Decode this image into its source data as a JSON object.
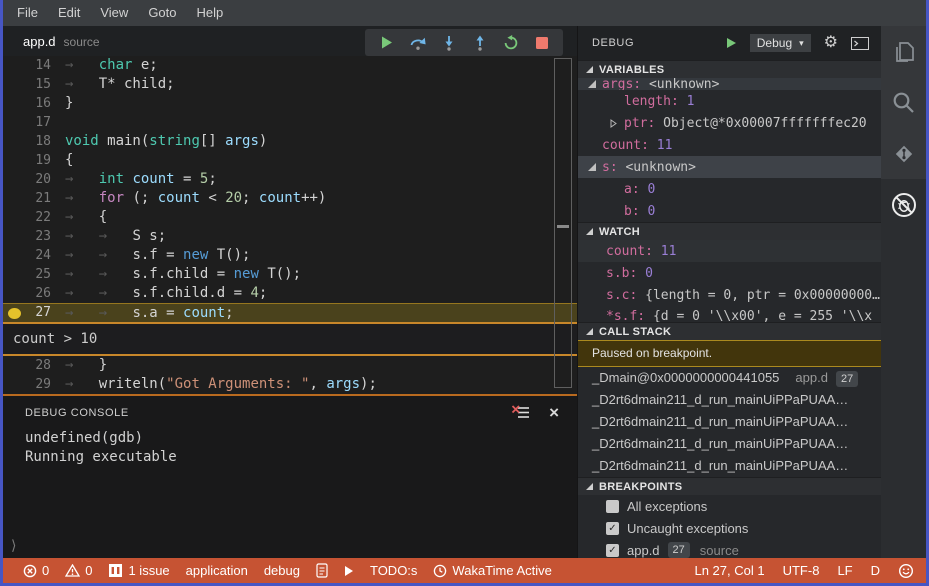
{
  "colors": {
    "window_border": "#4756c4",
    "statusbar_bg": "#c65333",
    "editor_bg": "#1e1e1e",
    "menu_bg": "#3b3e41",
    "sidebar_bg": "#26282b",
    "current_line_bg": "#4a421c",
    "breakpoint_accent": "#c8872a",
    "console_border": "#b96a1f",
    "continue_green": "#79c879",
    "step_blue": "#6fb6e8",
    "stop_red": "#ef7a6d",
    "var_name_pink": "#d16d9e",
    "var_value_purple": "#9a7fd6",
    "breakpoint_dot": "#e5c22b"
  },
  "menu": {
    "items": [
      "File",
      "Edit",
      "View",
      "Goto",
      "Help"
    ]
  },
  "tab": {
    "name": "app.d",
    "hint": "source"
  },
  "debug_toolbar": {
    "buttons": [
      {
        "icon": "continue"
      },
      {
        "icon": "step-over"
      },
      {
        "icon": "step-into"
      },
      {
        "icon": "step-out"
      },
      {
        "icon": "restart"
      },
      {
        "icon": "stop"
      }
    ]
  },
  "editor": {
    "condition_widget": "count > 10",
    "breakpoint_line": 27,
    "lines": [
      {
        "num": 14,
        "segs": [
          [
            "ws",
            "→   "
          ],
          [
            "type",
            "char"
          ],
          [
            "plain",
            " e;"
          ]
        ]
      },
      {
        "num": 15,
        "segs": [
          [
            "ws",
            "→   "
          ],
          [
            "plain",
            "T* child;"
          ]
        ]
      },
      {
        "num": 16,
        "segs": [
          [
            "plain",
            "}"
          ]
        ]
      },
      {
        "num": 17,
        "segs": []
      },
      {
        "num": 18,
        "segs": [
          [
            "type",
            "void"
          ],
          [
            "plain",
            " main("
          ],
          [
            "type",
            "string"
          ],
          [
            "plain",
            "[] "
          ],
          [
            "var",
            "args"
          ],
          [
            "plain",
            ")"
          ]
        ]
      },
      {
        "num": 19,
        "segs": [
          [
            "plain",
            "{"
          ]
        ]
      },
      {
        "num": 20,
        "segs": [
          [
            "ws",
            "→   "
          ],
          [
            "type",
            "int"
          ],
          [
            "plain",
            " "
          ],
          [
            "var",
            "count"
          ],
          [
            "plain",
            " = "
          ],
          [
            "num",
            "5"
          ],
          [
            "plain",
            ";"
          ]
        ]
      },
      {
        "num": 21,
        "segs": [
          [
            "ws",
            "→   "
          ],
          [
            "kw",
            "for"
          ],
          [
            "plain",
            " (; "
          ],
          [
            "var",
            "count"
          ],
          [
            "plain",
            " < "
          ],
          [
            "num",
            "20"
          ],
          [
            "plain",
            "; "
          ],
          [
            "var",
            "count"
          ],
          [
            "plain",
            "++)"
          ]
        ]
      },
      {
        "num": 22,
        "segs": [
          [
            "ws",
            "→   "
          ],
          [
            "plain",
            "{"
          ]
        ]
      },
      {
        "num": 23,
        "segs": [
          [
            "ws",
            "→   →   "
          ],
          [
            "plain",
            "S s;"
          ]
        ]
      },
      {
        "num": 24,
        "segs": [
          [
            "ws",
            "→   →   "
          ],
          [
            "plain",
            "s.f = "
          ],
          [
            "kw2",
            "new"
          ],
          [
            "plain",
            " T();"
          ]
        ]
      },
      {
        "num": 25,
        "segs": [
          [
            "ws",
            "→   →   "
          ],
          [
            "plain",
            "s.f.child = "
          ],
          [
            "kw2",
            "new"
          ],
          [
            "plain",
            " T();"
          ]
        ]
      },
      {
        "num": 26,
        "segs": [
          [
            "ws",
            "→   →   "
          ],
          [
            "plain",
            "s.f.child.d = "
          ],
          [
            "num",
            "4"
          ],
          [
            "plain",
            ";"
          ]
        ]
      },
      {
        "num": 27,
        "segs": [
          [
            "ws",
            "→   →   "
          ],
          [
            "plain",
            "s.a = "
          ],
          [
            "var",
            "count"
          ],
          [
            "plain",
            ";"
          ]
        ],
        "current": true,
        "breakpoint": true
      },
      {
        "num": 28,
        "segs": [
          [
            "ws",
            "→   "
          ],
          [
            "plain",
            "}"
          ]
        ]
      },
      {
        "num": 29,
        "segs": [
          [
            "ws",
            "→   "
          ],
          [
            "plain",
            "writeln("
          ],
          [
            "str",
            "\"Got Arguments: \""
          ],
          [
            "plain",
            ", "
          ],
          [
            "var",
            "args"
          ],
          [
            "plain",
            ");"
          ]
        ]
      }
    ]
  },
  "console": {
    "title": "DEBUG CONSOLE",
    "lines": [
      "undefined(gdb)",
      "Running executable"
    ],
    "prompt": "⟩"
  },
  "sidebar": {
    "title": "DEBUG",
    "config": "Debug",
    "sections": {
      "variables": {
        "label": "VARIABLES",
        "rows": [
          {
            "twistie": "open",
            "name": "args",
            "value": "<unknown>",
            "vtype": "plain",
            "indent": 0,
            "clip": "top"
          },
          {
            "name": "length",
            "value": "1",
            "vtype": "num",
            "indent": 1
          },
          {
            "twistie": "closed",
            "name": "ptr",
            "value": "Object@*0x00007fffffffec20",
            "vtype": "plain",
            "indent": 1
          },
          {
            "name": "count",
            "value": "11",
            "vtype": "num",
            "indent": 0
          },
          {
            "twistie": "open",
            "name": "s",
            "value": "<unknown>",
            "vtype": "plain",
            "indent": 0,
            "selected": true
          },
          {
            "name": "a",
            "value": "0",
            "vtype": "num",
            "indent": 1
          },
          {
            "name": "b",
            "value": "0",
            "vtype": "num",
            "indent": 1
          }
        ]
      },
      "watch": {
        "label": "WATCH",
        "rows": [
          {
            "name": "count",
            "value": "11",
            "vtype": "num",
            "hover": true
          },
          {
            "name": "s.b",
            "value": "0",
            "vtype": "num"
          },
          {
            "name": "s.c",
            "value": "{length = 0, ptr = 0x00000000…",
            "vtype": "plain"
          },
          {
            "name": "*s.f",
            "value": "{d = 0 '\\\\x00', e = 255 '\\\\x",
            "vtype": "plain",
            "clip": "bottom"
          }
        ]
      },
      "callstack": {
        "label": "CALL STACK",
        "status": "Paused on breakpoint.",
        "frames": [
          {
            "name": "_Dmain@0x0000000000441055",
            "file": "app.d",
            "line": "27"
          },
          {
            "name": "_D2rt6dmain211_d_run_mainUiPPaPUAA…"
          },
          {
            "name": "_D2rt6dmain211_d_run_mainUiPPaPUAA…"
          },
          {
            "name": "_D2rt6dmain211_d_run_mainUiPPaPUAA…"
          },
          {
            "name": "_D2rt6dmain211_d_run_mainUiPPaPUAA…"
          }
        ]
      },
      "breakpoints": {
        "label": "BREAKPOINTS",
        "rows": [
          {
            "checked": false,
            "label": "All exceptions"
          },
          {
            "checked": true,
            "label": "Uncaught exceptions"
          },
          {
            "checked": true,
            "label": "app.d",
            "badge": "27",
            "hint": "source"
          }
        ]
      }
    }
  },
  "activity_bar": {
    "items": [
      {
        "icon": "files"
      },
      {
        "icon": "search"
      },
      {
        "icon": "git"
      },
      {
        "icon": "debug",
        "active": true
      }
    ]
  },
  "statusbar": {
    "left": [
      {
        "icon": "error-circle",
        "text": "0"
      },
      {
        "icon": "warning-triangle",
        "text": "0"
      },
      {
        "icon": "issues-square",
        "text": "1 issue"
      },
      {
        "text": "application"
      },
      {
        "text": "debug"
      },
      {
        "icon": "report-doc"
      },
      {
        "icon": "play-small"
      },
      {
        "text": "TODO:s"
      },
      {
        "icon": "clock",
        "text": "WakaTime Active"
      }
    ],
    "right": [
      {
        "text": "Ln 27, Col 1"
      },
      {
        "text": "UTF-8"
      },
      {
        "text": "LF"
      },
      {
        "text": "D"
      },
      {
        "icon": "smiley"
      }
    ]
  }
}
